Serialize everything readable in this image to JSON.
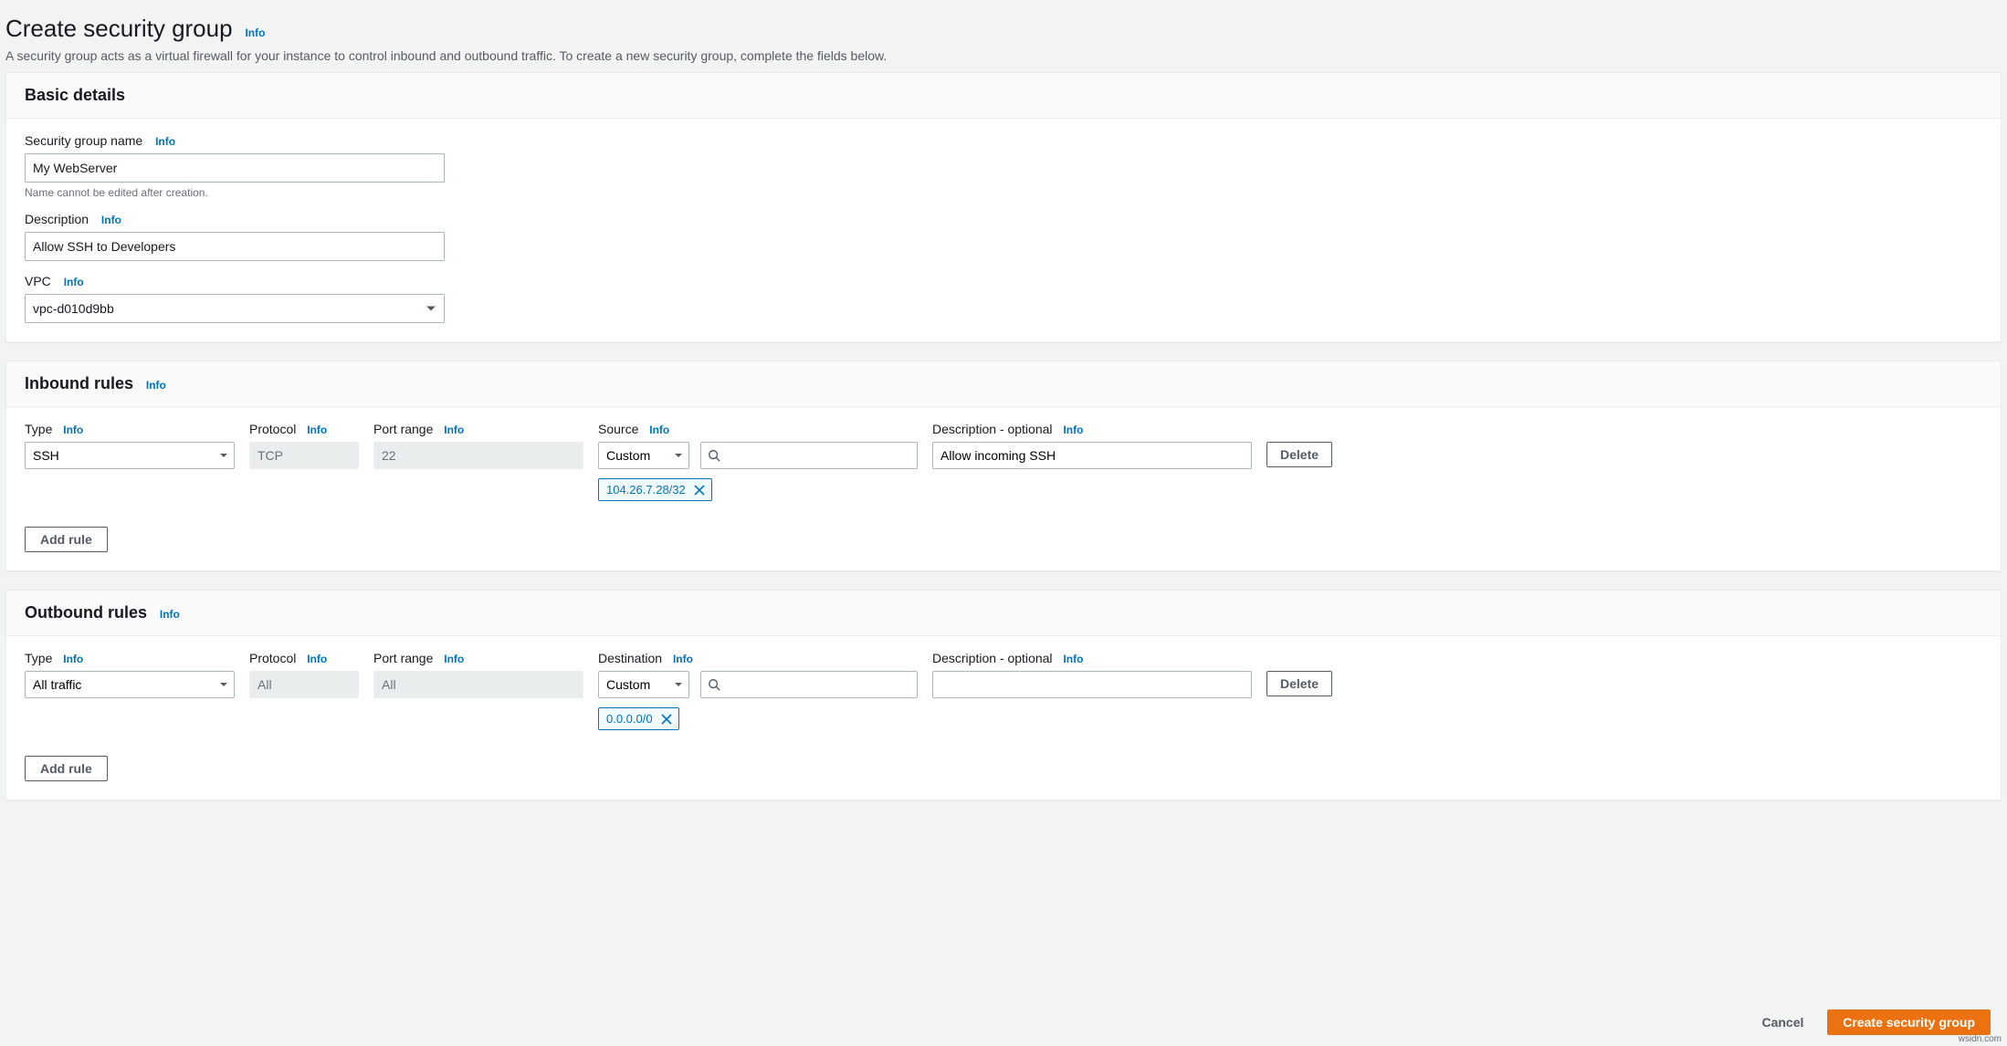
{
  "header": {
    "title": "Create security group",
    "info": "Info",
    "subtitle": "A security group acts as a virtual firewall for your instance to control inbound and outbound traffic. To create a new security group, complete the fields below."
  },
  "basic": {
    "panel_title": "Basic details",
    "name_label": "Security group name",
    "name_info": "Info",
    "name_value": "My WebServer",
    "name_helper": "Name cannot be edited after creation.",
    "desc_label": "Description",
    "desc_info": "Info",
    "desc_value": "Allow SSH to Developers",
    "vpc_label": "VPC",
    "vpc_info": "Info",
    "vpc_value": "vpc-d010d9bb"
  },
  "inbound": {
    "panel_title": "Inbound rules",
    "info": "Info",
    "columns": {
      "type": "Type",
      "protocol": "Protocol",
      "port_range": "Port range",
      "source": "Source",
      "description": "Description - optional"
    },
    "col_info": "Info",
    "rule": {
      "type": "SSH",
      "protocol": "TCP",
      "port_range": "22",
      "source_mode": "Custom",
      "source_chip": "104.26.7.28/32",
      "description": "Allow incoming SSH"
    },
    "delete_label": "Delete",
    "add_rule_label": "Add rule"
  },
  "outbound": {
    "panel_title": "Outbound rules",
    "info": "Info",
    "columns": {
      "type": "Type",
      "protocol": "Protocol",
      "port_range": "Port range",
      "destination": "Destination",
      "description": "Description - optional"
    },
    "col_info": "Info",
    "rule": {
      "type": "All traffic",
      "protocol": "All",
      "port_range": "All",
      "destination_mode": "Custom",
      "destination_chip": "0.0.0.0/0",
      "description": ""
    },
    "delete_label": "Delete",
    "add_rule_label": "Add rule"
  },
  "footer": {
    "cancel": "Cancel",
    "submit": "Create security group"
  },
  "attribution": "wsidn.com"
}
